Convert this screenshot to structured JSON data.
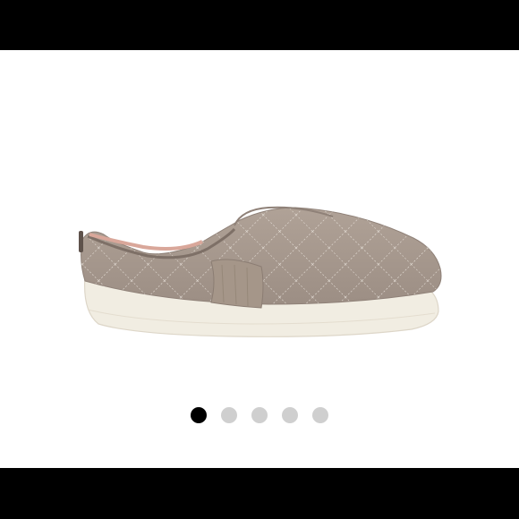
{
  "carousel": {
    "image_icon": "slip-on-quilted-sneaker",
    "dots": [
      {
        "active": true
      },
      {
        "active": false
      },
      {
        "active": false
      },
      {
        "active": false
      },
      {
        "active": false
      }
    ],
    "colors": {
      "active_dot": "#000000",
      "inactive_dot": "#cfcfcf",
      "shoe_upper": "#a89a90",
      "sole": "#f2eee3"
    }
  }
}
